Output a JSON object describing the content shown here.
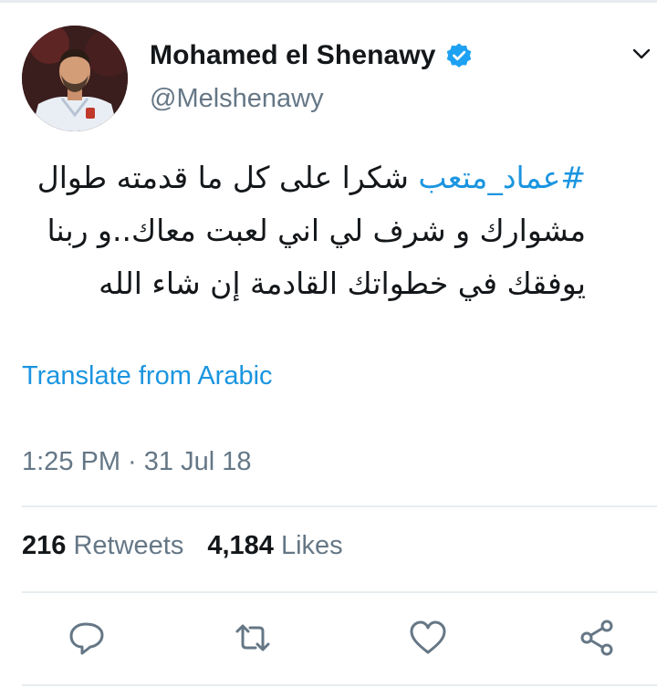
{
  "tweet": {
    "author": {
      "display_name": "Mohamed el Shenawy",
      "handle": "@Melshenawy",
      "verified": true
    },
    "text": {
      "hashtag": "#عماد_متعب",
      "body": " شكرا على كل ما قدمته طوال مشوارك و شرف لي اني لعبت معاك..و ربنا يوفقك في خطواتك القادمة إن شاء الله"
    },
    "translate_label": "Translate from Arabic",
    "timestamp": "1:25 PM · 31 Jul 18",
    "stats": {
      "retweets_count": "216",
      "retweets_label": "Retweets",
      "likes_count": "4,184",
      "likes_label": "Likes"
    }
  },
  "icons": [
    "verified-badge-icon",
    "chevron-down-icon",
    "reply-icon",
    "retweet-icon",
    "like-icon",
    "share-icon"
  ],
  "colors": {
    "link": "#1b95e0",
    "secondary_text": "#657786",
    "primary_text": "#14171a",
    "divider": "#e6ecf0"
  }
}
